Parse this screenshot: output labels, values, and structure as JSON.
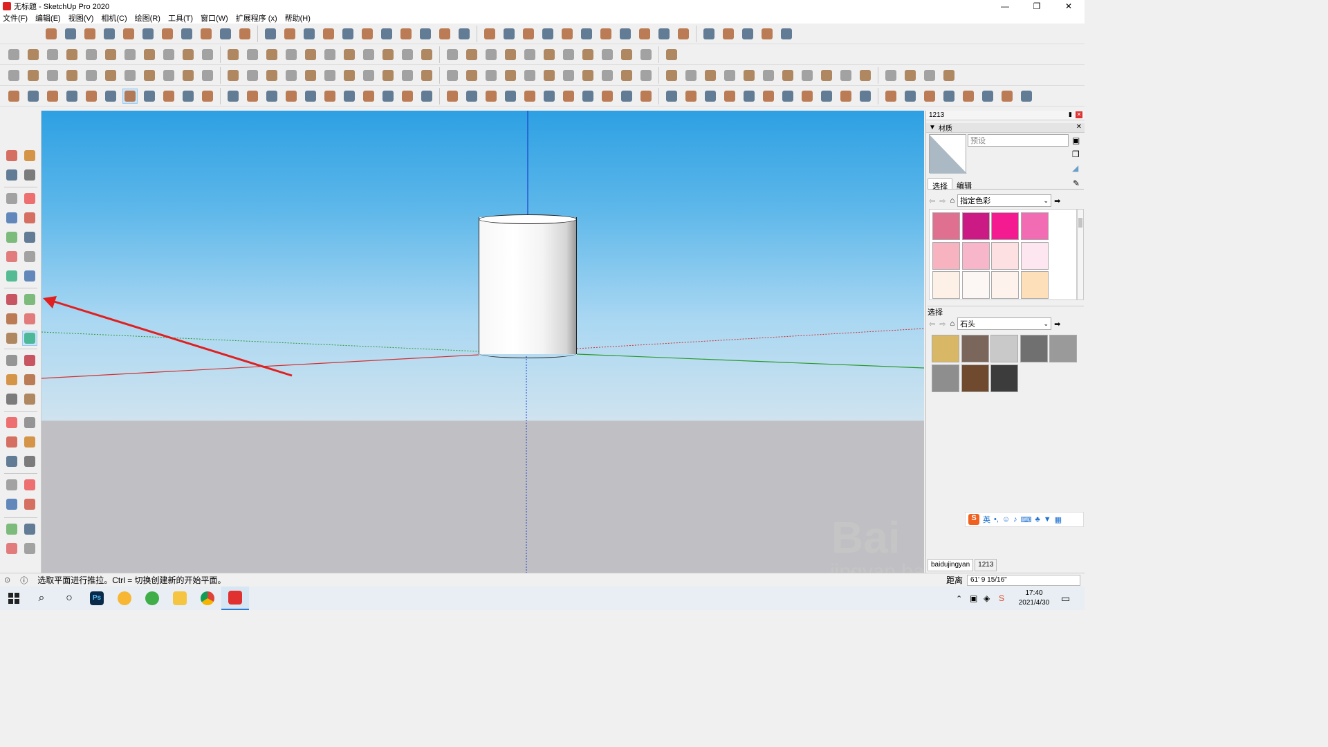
{
  "window": {
    "title": "无标题 - SketchUp Pro 2020",
    "controls": [
      "—",
      "❐",
      "✕"
    ]
  },
  "menu": [
    "文件(F)",
    "编辑(E)",
    "视图(V)",
    "相机(C)",
    "绘图(R)",
    "工具(T)",
    "窗口(W)",
    "扩展程序 (x)",
    "帮助(H)"
  ],
  "colors": {
    "sky_top": "#2da0e3",
    "ground": "#c0c0c4",
    "red_axis": "#d23030",
    "green_axis": "#2a9a2a",
    "blue_axis": "#1d3fcf",
    "annotation_arrow": "#e02020"
  },
  "panel": {
    "tray_title": "1213",
    "section_title": "材质",
    "material_name_placeholder": "预设",
    "tabs": [
      "选择",
      "编辑"
    ],
    "library1": "指定色彩",
    "swatches1": [
      "#e07090",
      "#cc1a84",
      "#f41a8f",
      "#f26cb4",
      "#f8b3c1",
      "#f7b6ca",
      "#fde0e2",
      "#fde6ef",
      "#fdf0e6",
      "#fcf7f4",
      "#fdf2ec",
      "#fde0b9"
    ],
    "section2_title": "选择",
    "library2": "石头",
    "swatches2": [
      "#d8b866",
      "#7a665a",
      "#c9c9c9",
      "#707070",
      "#9a9a9a",
      "#8e8e8e",
      "#6f4a2e",
      "#3c3c3c"
    ],
    "bottom_tabs": [
      "baidujingyan",
      "1213"
    ]
  },
  "ime": {
    "lang": "英"
  },
  "status": {
    "message": "选取平面进行推拉。Ctrl = 切换创建新的开始平面。",
    "measure_label": "距离",
    "measure_value": "61' 9 15/16\""
  },
  "clock": {
    "time": "17:40",
    "date": "2021/4/30"
  },
  "watermark": {
    "brand": "Bai du 经验",
    "url": "jingyan.baidu.com"
  }
}
